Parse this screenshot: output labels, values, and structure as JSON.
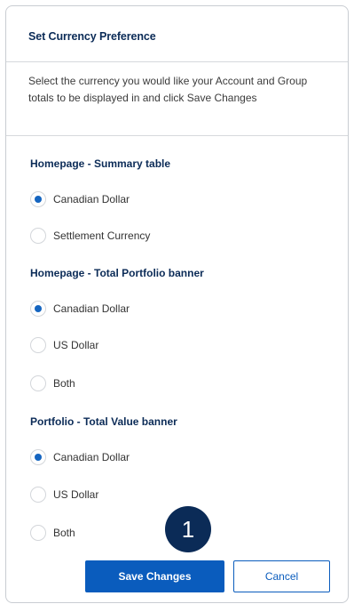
{
  "panel": {
    "title": "Set Currency Preference",
    "intro": "Select the currency you would like your Account and Group totals to be displayed in and click Save Changes"
  },
  "sections": [
    {
      "title": "Homepage - Summary table",
      "options": [
        {
          "label": "Canadian Dollar",
          "checked": true
        },
        {
          "label": "Settlement Currency",
          "checked": false
        }
      ]
    },
    {
      "title": "Homepage - Total Portfolio banner",
      "options": [
        {
          "label": "Canadian Dollar",
          "checked": true
        },
        {
          "label": "US Dollar",
          "checked": false
        },
        {
          "label": "Both",
          "checked": false
        }
      ]
    },
    {
      "title": "Portfolio - Total Value banner",
      "options": [
        {
          "label": "Canadian Dollar",
          "checked": true
        },
        {
          "label": "US Dollar",
          "checked": false
        },
        {
          "label": "Both",
          "checked": false
        }
      ]
    }
  ],
  "callout": {
    "label": "1"
  },
  "buttons": {
    "save_label": "Save Changes",
    "cancel_label": "Cancel"
  },
  "colors": {
    "accent": "#0a5cbd",
    "heading": "#0b2b57",
    "radio_selected": "#1565c0",
    "callout_bg": "#0b2b57"
  }
}
